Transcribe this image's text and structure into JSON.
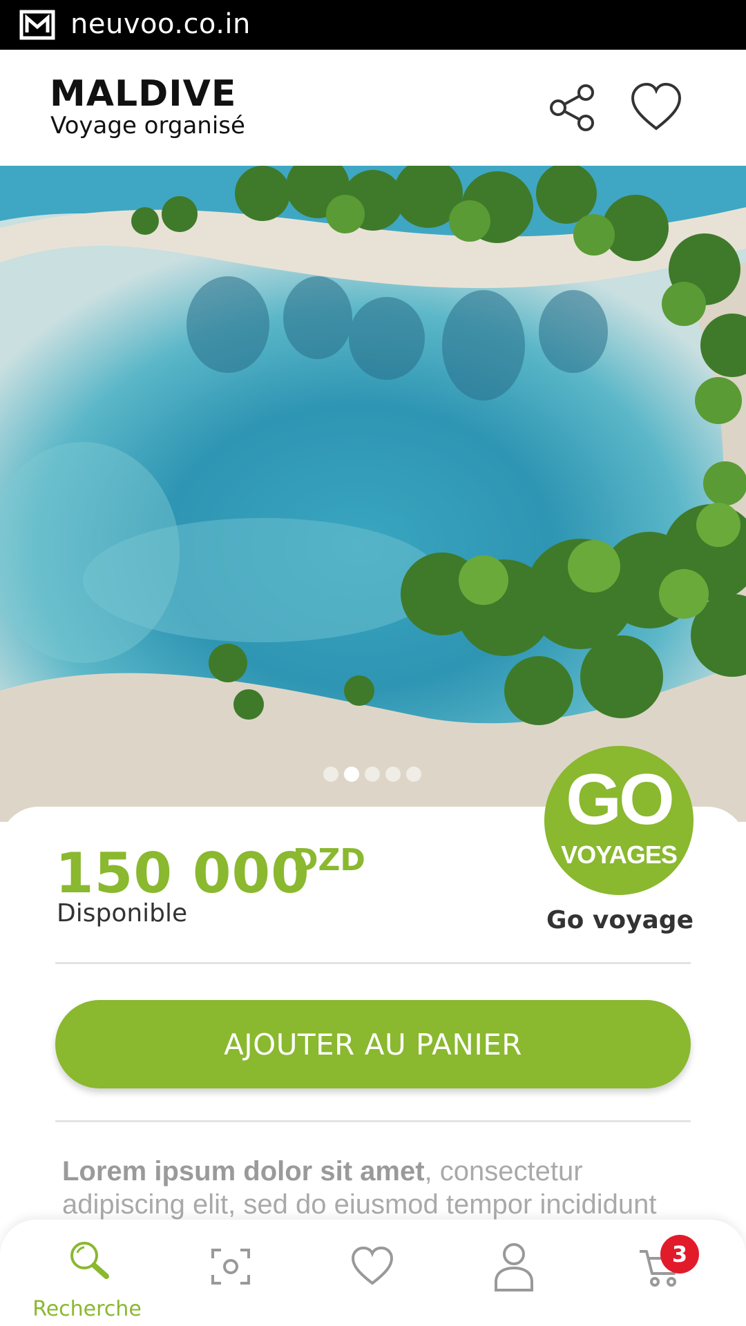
{
  "status_bar": {
    "site": "neuvoo.co.in",
    "icon": "mail-icon"
  },
  "header": {
    "title": "MALDIVE",
    "subtitle": "Voyage organisé",
    "share_icon": "share-icon",
    "favorite_icon": "heart-icon"
  },
  "hero": {
    "carousel_total": 5,
    "carousel_active": 2
  },
  "product": {
    "price": "150 000",
    "currency": "DZD",
    "availability": "Disponible",
    "vendor_logo_top": "GO",
    "vendor_logo_bottom": "VOYAGES",
    "vendor_name": "Go voyage",
    "add_to_cart": "AJOUTER AU PANIER",
    "description_bold": "Lorem ipsum dolor sit amet",
    "description_rest": ", consectetur adipiscing elit, sed do eiusmod tempor incididunt"
  },
  "bottom_nav": {
    "items": [
      {
        "label": "Recherche",
        "icon": "search-icon",
        "active": true
      },
      {
        "label": "",
        "icon": "scan-icon",
        "active": false
      },
      {
        "label": "",
        "icon": "heart-icon",
        "active": false
      },
      {
        "label": "",
        "icon": "user-icon",
        "active": false
      },
      {
        "label": "",
        "icon": "cart-icon",
        "active": false
      }
    ],
    "cart_badge": "3"
  },
  "colors": {
    "accent": "#8ab82f",
    "badge": "#e21b2b",
    "status_bar": "#000000"
  }
}
